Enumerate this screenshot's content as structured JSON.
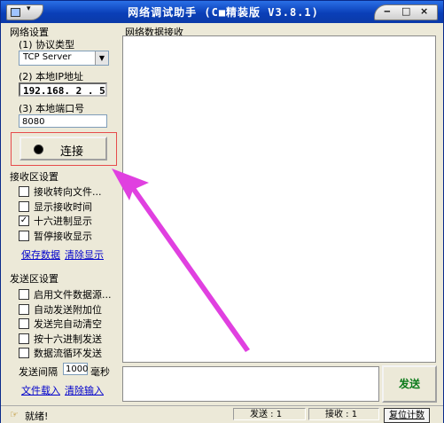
{
  "window": {
    "title": "网络调试助手 (C■精装版 V3.8.1)",
    "controls": {
      "minimize": "‒",
      "maximize": "□",
      "close": "×"
    }
  },
  "network_settings": {
    "group_title": "网络设置",
    "protocol_label": "(1) 协议类型",
    "protocol_value": "TCP Server",
    "ip_label": "(2) 本地IP地址",
    "ip_value": "192.168. 2 . 5",
    "port_label": "(3) 本地端口号",
    "port_value": "8080",
    "connect_label": "连接"
  },
  "receive_settings": {
    "group_title": "接收区设置",
    "options": [
      {
        "label": "接收转向文件...",
        "checked": false
      },
      {
        "label": "显示接收时间",
        "checked": false
      },
      {
        "label": "十六进制显示",
        "checked": true
      },
      {
        "label": "暂停接收显示",
        "checked": false
      }
    ],
    "save_data": "保存数据",
    "clear_display": "清除显示"
  },
  "send_settings": {
    "group_title": "发送区设置",
    "options": [
      {
        "label": "启用文件数据源...",
        "checked": false
      },
      {
        "label": "自动发送附加位",
        "checked": false
      },
      {
        "label": "发送完自动清空",
        "checked": false
      },
      {
        "label": "按十六进制发送",
        "checked": false
      },
      {
        "label": "数据流循环发送",
        "checked": false
      }
    ],
    "interval_label": "发送间隔",
    "interval_value": "1000",
    "interval_unit": "毫秒",
    "file_load": "文件载入",
    "clear_input": "清除输入"
  },
  "receive_panel": {
    "title": "网络数据接收"
  },
  "send_button": "发送",
  "status_bar": {
    "ready": "就绪!",
    "sent": "发送 : 1",
    "received": "接收 : 1",
    "reset": "复位计数"
  },
  "annotation_color": "#e040e0"
}
